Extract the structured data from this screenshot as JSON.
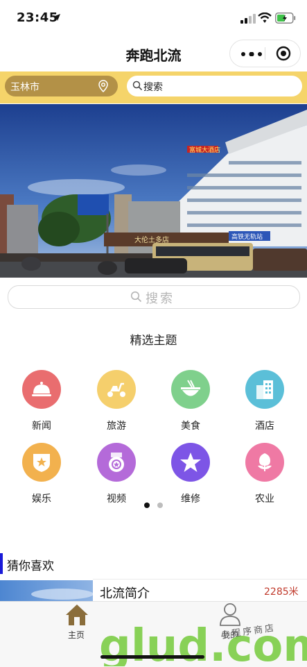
{
  "status_bar": {
    "time": "23:45"
  },
  "nav": {
    "title": "奔跑北流"
  },
  "top_search": {
    "city": "玉林市",
    "search_placeholder": "搜索"
  },
  "banner": {
    "sign_text": "大伦土多店",
    "building_sign": "富城大酒店",
    "side_sign": "高铁无轨站"
  },
  "main_search": {
    "placeholder": "搜索"
  },
  "featured": {
    "title": "精选主题",
    "topics": [
      {
        "label": "新闻",
        "icon": "cloche-icon",
        "color": "#e96d6f"
      },
      {
        "label": "旅游",
        "icon": "scooter-icon",
        "color": "#f5cf6c"
      },
      {
        "label": "美食",
        "icon": "bowl-icon",
        "color": "#7fd08c"
      },
      {
        "label": "酒店",
        "icon": "building-icon",
        "color": "#5bbfd8"
      },
      {
        "label": "娱乐",
        "icon": "badge-icon",
        "color": "#f2b14e"
      },
      {
        "label": "视频",
        "icon": "medal-icon",
        "color": "#b46ad9"
      },
      {
        "label": "维修",
        "icon": "star-icon",
        "color": "#7d55e6"
      },
      {
        "label": "农业",
        "icon": "flower-icon",
        "color": "#ef79a4"
      }
    ],
    "page_dots": {
      "active": 1,
      "total": 2
    }
  },
  "guess": {
    "title": "猜你喜欢",
    "items": [
      {
        "title": "北流简介",
        "distance": "2285米"
      }
    ]
  },
  "tabbar": {
    "home_label": "主页",
    "me_label": "我的"
  },
  "watermark": {
    "text": "glud.com",
    "note": "小程序商店"
  }
}
